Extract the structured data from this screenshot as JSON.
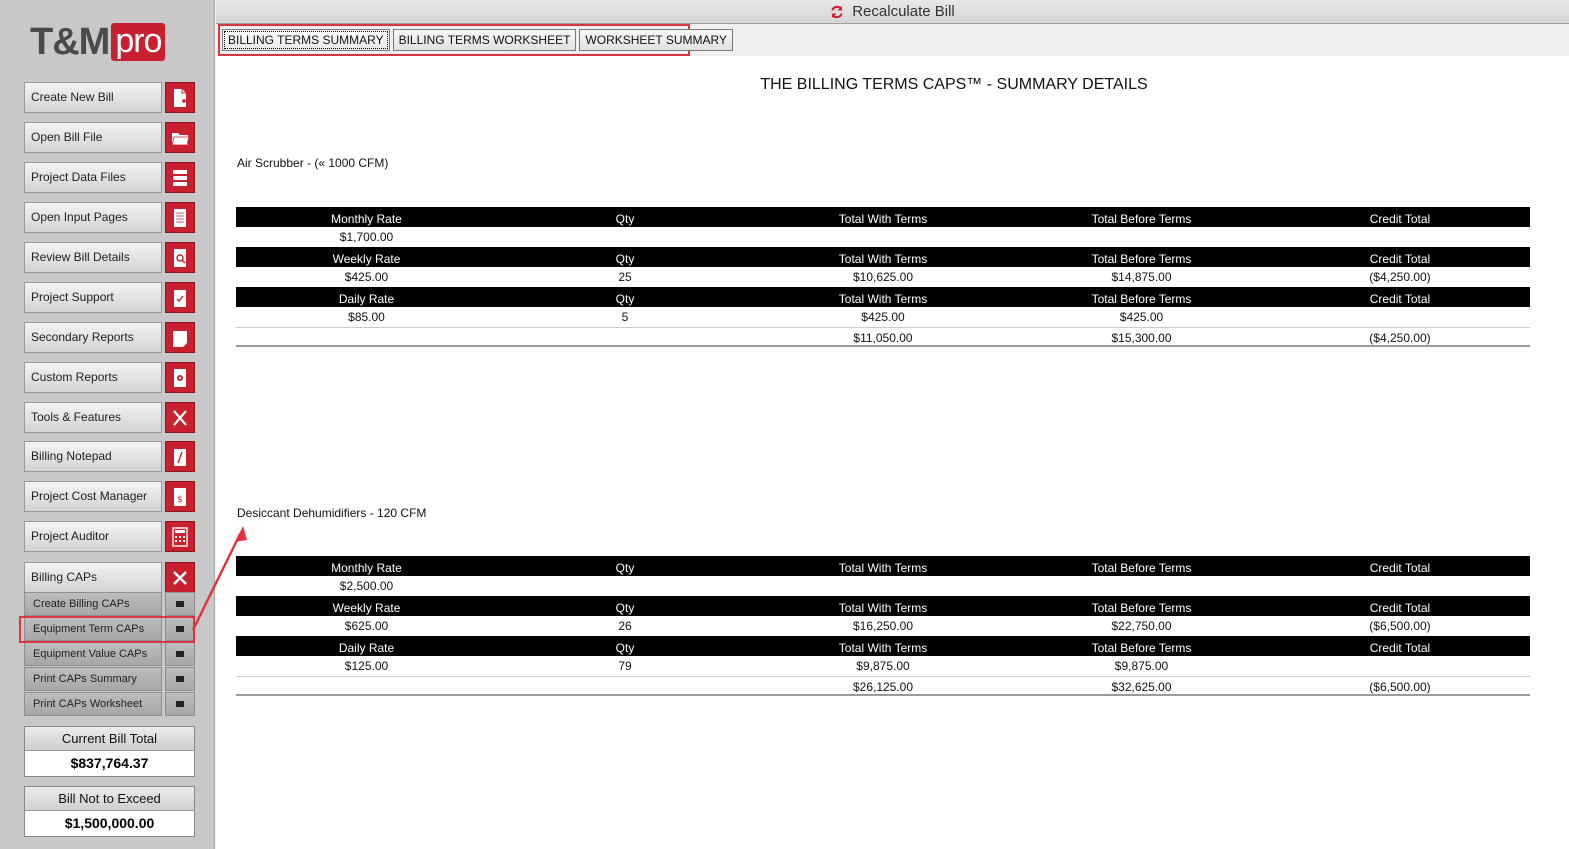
{
  "logo": {
    "main": "T&M",
    "accent": "pro"
  },
  "topbar": {
    "recalc_label": "Recalculate Bill"
  },
  "tabs": [
    {
      "label": "BILLING TERMS SUMMARY",
      "active": true
    },
    {
      "label": "BILLING TERMS WORKSHEET",
      "active": false
    },
    {
      "label": "WORKSHEET SUMMARY",
      "active": false
    }
  ],
  "sidebar": {
    "items": [
      {
        "label": "Create New Bill",
        "icon": "new-document-icon"
      },
      {
        "label": "Open Bill File",
        "icon": "folder-open-icon"
      },
      {
        "label": "Project Data Files",
        "icon": "server-icon"
      },
      {
        "label": "Open Input Pages",
        "icon": "page-icon"
      },
      {
        "label": "Review Bill Details",
        "icon": "magnify-doc-icon"
      },
      {
        "label": "Project Support",
        "icon": "checklist-icon"
      },
      {
        "label": "Secondary Reports",
        "icon": "report-icon"
      },
      {
        "label": "Custom Reports",
        "icon": "gear-doc-icon"
      },
      {
        "label": "Tools & Features",
        "icon": "tools-icon"
      },
      {
        "label": "Billing Notepad",
        "icon": "notepad-icon"
      },
      {
        "label": "Project Cost Manager",
        "icon": "dollar-doc-icon"
      },
      {
        "label": "Project Auditor",
        "icon": "calculator-icon"
      },
      {
        "label": "Billing CAPs",
        "icon": "close-icon"
      }
    ],
    "sub_items": [
      {
        "label": "Create Billing CAPs"
      },
      {
        "label": "Equipment Term CAPs"
      },
      {
        "label": "Equipment Value CAPs"
      },
      {
        "label": "Print CAPs Summary"
      },
      {
        "label": "Print CAPs Worksheet"
      }
    ],
    "current_total": {
      "label": "Current Bill Total",
      "value": "$837,764.37"
    },
    "not_to_exceed": {
      "label": "Bill Not to Exceed",
      "value": "$1,500,000.00"
    }
  },
  "main": {
    "title": "THE BILLING TERMS CAPS™ -  SUMMARY DETAILS",
    "sections": [
      {
        "name": "Air Scrubber - (« 1000 CFM)",
        "monthly": {
          "header": [
            "Monthly Rate",
            "Qty",
            "Total With Terms",
            "Total Before Terms",
            "Credit Total"
          ],
          "row": [
            "$1,700.00",
            "",
            "",
            "",
            ""
          ]
        },
        "weekly": {
          "header": [
            "Weekly Rate",
            "Qty",
            "Total With Terms",
            "Total Before Terms",
            "Credit Total"
          ],
          "row": [
            "$425.00",
            "25",
            "$10,625.00",
            "$14,875.00",
            "($4,250.00)"
          ]
        },
        "daily": {
          "header": [
            "Daily Rate",
            "Qty",
            "Total With Terms",
            "Total Before Terms",
            "Credit Total"
          ],
          "row": [
            "$85.00",
            "5",
            "$425.00",
            "$425.00",
            ""
          ]
        },
        "total": [
          "",
          "",
          "$11,050.00",
          "$15,300.00",
          "($4,250.00)"
        ]
      },
      {
        "name": "Desiccant Dehumidifiers - 120 CFM",
        "monthly": {
          "header": [
            "Monthly Rate",
            "Qty",
            "Total With Terms",
            "Total Before Terms",
            "Credit Total"
          ],
          "row": [
            "$2,500.00",
            "",
            "",
            "",
            ""
          ]
        },
        "weekly": {
          "header": [
            "Weekly Rate",
            "Qty",
            "Total With Terms",
            "Total Before Terms",
            "Credit Total"
          ],
          "row": [
            "$625.00",
            "26",
            "$16,250.00",
            "$22,750.00",
            "($6,500.00)"
          ]
        },
        "daily": {
          "header": [
            "Daily Rate",
            "Qty",
            "Total With Terms",
            "Total Before Terms",
            "Credit Total"
          ],
          "row": [
            "$125.00",
            "79",
            "$9,875.00",
            "$9,875.00",
            ""
          ]
        },
        "total": [
          "",
          "",
          "$26,125.00",
          "$32,625.00",
          "($6,500.00)"
        ]
      }
    ]
  },
  "colors": {
    "brand_red": "#c8202e",
    "highlight": "#e0343c"
  }
}
